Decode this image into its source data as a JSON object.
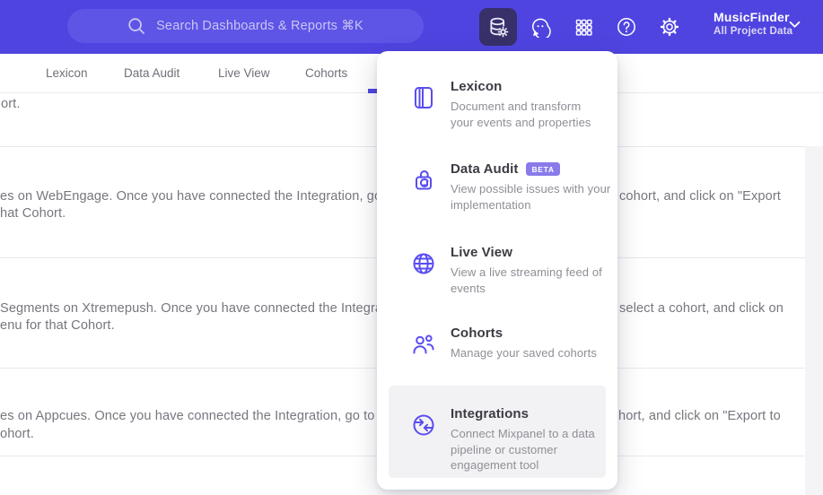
{
  "colors": {
    "header_bg": "#4f44e0",
    "accent": "#4f44e0",
    "menu_icon": "#5a4df0",
    "badge_bg": "#897bea",
    "highlight_bg": "#f2f2f4"
  },
  "header": {
    "search": {
      "placeholder": "Search Dashboards & Reports ⌘K"
    },
    "icons": [
      "data-management-icon",
      "feedback-icon",
      "apps-grid-icon",
      "help-icon",
      "settings-icon"
    ],
    "project": {
      "name": "MusicFinder",
      "scope": "All Project Data"
    }
  },
  "nav": {
    "tabs": [
      {
        "label": "Lexicon"
      },
      {
        "label": "Data Audit"
      },
      {
        "label": "Live View"
      },
      {
        "label": "Cohorts"
      }
    ]
  },
  "content": {
    "rows": [
      {
        "left2": "ort."
      },
      {
        "left1": "es on WebEngage. Once you have connected the Integration, go to the",
        "right1": "cohort, and click on \"Export",
        "left2": "hat Cohort."
      },
      {
        "left1": "Segments on Xtremepush. Once you have connected the Integration,",
        "right1": "select a cohort, and click on",
        "left2": "enu for that Cohort."
      },
      {
        "left1": "es on Appcues. Once you have connected the Integration, go to the M",
        "right1": "hort, and click on \"Export to",
        "left2": "ohort."
      }
    ]
  },
  "menu": {
    "items": [
      {
        "title": "Lexicon",
        "badge": "",
        "icon": "book-icon",
        "description_lines": [
          "Document and transform",
          "your events and properties"
        ]
      },
      {
        "title": "Data Audit",
        "badge": "BETA",
        "icon": "audit-lock-icon",
        "description_lines": [
          "View possible issues with your",
          "implementation"
        ]
      },
      {
        "title": "Live View",
        "badge": "",
        "icon": "globe-icon",
        "description_lines": [
          "View a live streaming feed of",
          "events"
        ]
      },
      {
        "title": "Cohorts",
        "badge": "",
        "icon": "people-icon",
        "description_lines": [
          "Manage your saved cohorts"
        ]
      },
      {
        "title": "Integrations",
        "badge": "",
        "icon": "sync-arrows-icon",
        "description_lines": [
          "Connect Mixpanel to a data",
          "pipeline or customer",
          "engagement tool"
        ]
      }
    ]
  }
}
